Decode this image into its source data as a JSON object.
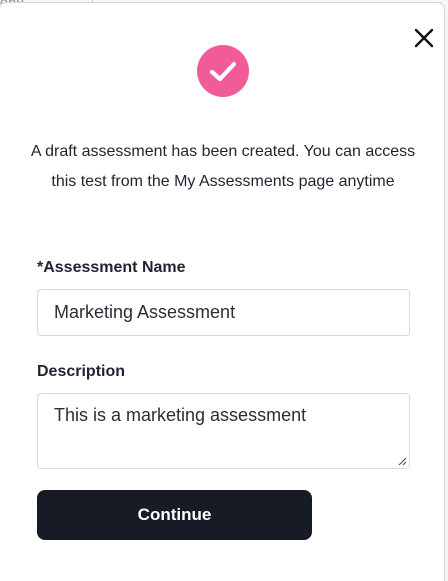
{
  "background": {
    "partial_text": "ony"
  },
  "modal": {
    "close_icon": "close-icon",
    "success_icon": "check-icon",
    "accent_color": "#f15c98",
    "message": "A draft assessment has been created. You can access this test from the My Assessments page anytime"
  },
  "form": {
    "name_label": "*Assessment Name",
    "name_value": "Marketing Assessment",
    "description_label": "Description",
    "description_value": "This is a marketing assessment"
  },
  "actions": {
    "continue_label": "Continue",
    "continue_color": "#161b26"
  }
}
